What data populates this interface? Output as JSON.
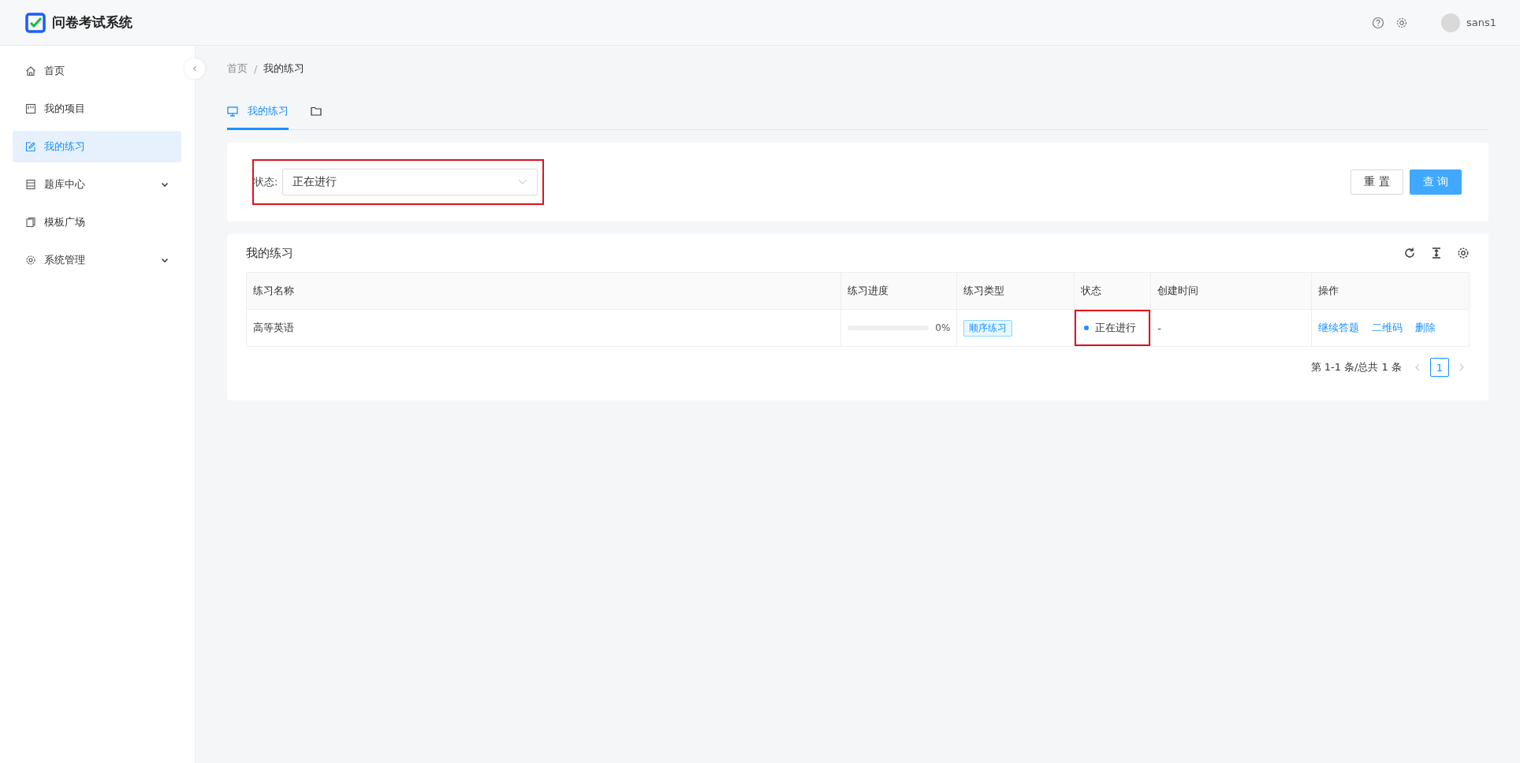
{
  "header": {
    "title": "问卷考试系统",
    "username": "sans1"
  },
  "sidebar": {
    "items": [
      {
        "label": "首页",
        "kind": "link",
        "selected": false
      },
      {
        "label": "我的项目",
        "kind": "link",
        "selected": false
      },
      {
        "label": "我的练习",
        "kind": "link",
        "selected": true
      },
      {
        "label": "题库中心",
        "kind": "group",
        "selected": false
      },
      {
        "label": "模板广场",
        "kind": "link",
        "selected": false
      },
      {
        "label": "系统管理",
        "kind": "group",
        "selected": false
      }
    ]
  },
  "breadcrumb": {
    "items": [
      "首页",
      "我的练习"
    ],
    "separator": "/"
  },
  "tabs": [
    {
      "label": "我的练习",
      "selected": true
    },
    {
      "selected": false
    }
  ],
  "filter": {
    "label": "状态:",
    "value": "正在进行",
    "buttons": [
      {
        "label": "重 置",
        "kind": "default"
      },
      {
        "label": "查 询",
        "kind": "primary"
      }
    ]
  },
  "table": {
    "title": "我的练习",
    "columns": [
      "练习名称",
      "练习进度",
      "练习类型",
      "状态",
      "创建时间",
      "操作"
    ],
    "rows": [
      {
        "name": "高等英语",
        "progress": {
          "level": 0,
          "reading": "0%"
        },
        "type": "顺序练习",
        "status": {
          "text": "正在进行",
          "color": "#1890ff"
        },
        "created": "-",
        "actions": [
          "继续答题",
          "二维码",
          "删除"
        ]
      }
    ]
  },
  "pagination": {
    "summary": "第 1-1 条/总共 1 条",
    "pages": [
      {
        "label": "1",
        "selected": true
      }
    ]
  }
}
